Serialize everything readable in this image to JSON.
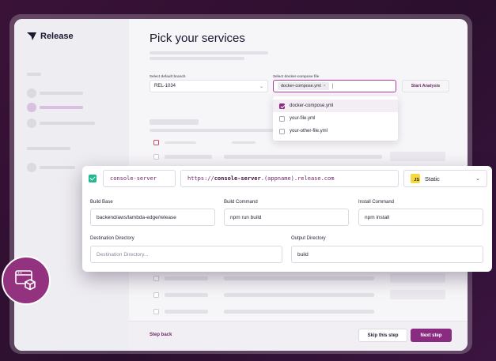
{
  "brand": {
    "name": "Release"
  },
  "page": {
    "title": "Pick your services"
  },
  "branch": {
    "label": "Select default branch",
    "value": "REL-1034"
  },
  "compose": {
    "label": "Select docker-compose file",
    "selected_chip": "docker-compose.yml",
    "options": [
      {
        "label": "docker-compose.yml",
        "checked": true
      },
      {
        "label": "your-file.yml",
        "checked": false
      },
      {
        "label": "your-other-file.yml",
        "checked": false
      }
    ]
  },
  "actions": {
    "start_analysis": "Start Analysis"
  },
  "service": {
    "name": "console-server",
    "url_prefix": "https://",
    "url_host": "console-server",
    "url_suffix": ".(appname).release.com",
    "runtime_badge": "JS",
    "runtime": "Static",
    "build_base_label": "Build Base",
    "build_base": "backend/aws/lambda-edge/release",
    "build_command_label": "Build Command",
    "build_command": "npm run build",
    "install_command_label": "Install Command",
    "install_command": "npm install",
    "dest_dir_label": "Destination Directory",
    "dest_dir_placeholder": "Destination Directory...",
    "output_dir_label": "Output Directory",
    "output_dir": "build"
  },
  "footer": {
    "step_back": "Step back",
    "skip": "Skip this step",
    "next": "Next step"
  },
  "colors": {
    "accent": "#8a2b82",
    "check": "#1fb98f",
    "background": "#2b0f2e"
  },
  "icons": [
    "release-logo-icon",
    "chevron-down-icon",
    "close-icon",
    "browser-package-icon"
  ]
}
